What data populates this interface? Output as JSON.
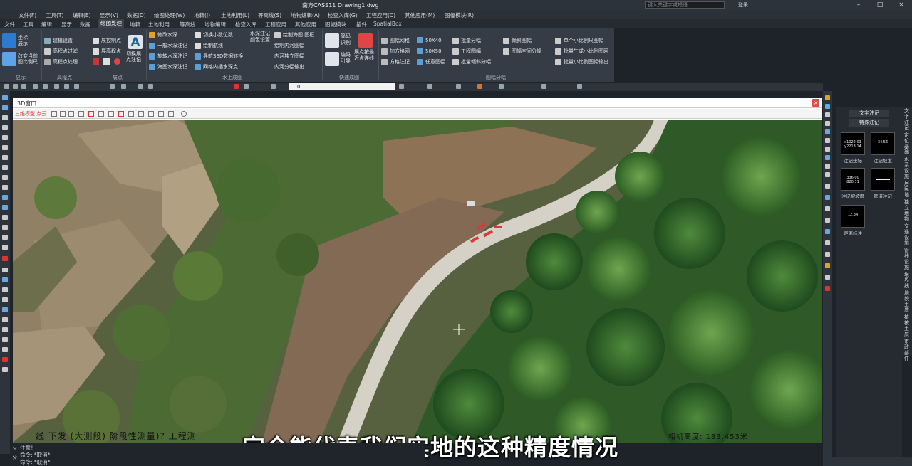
{
  "app": {
    "title": "南方CASS11   Drawing1.dwg",
    "search_placeholder": "键入关键字或短语",
    "login": "登录"
  },
  "menu": [
    "文件(F)",
    "工具(T)",
    "编辑(E)",
    "显示(V)",
    "数据(D)",
    "绘图处理(W)",
    "地籍(J)",
    "土地利用(L)",
    "等高线(S)",
    "地物编辑(A)",
    "检查入库(G)",
    "工程应用(C)",
    "其他应用(M)",
    "图幅模块(R)"
  ],
  "ribbon_tabs": [
    "文件",
    "工具",
    "编辑",
    "显示",
    "数据",
    "绘图处理",
    "地籍",
    "土地利用",
    "等高线",
    "地物编辑",
    "检查入库",
    "工程应用",
    "其他应用",
    "图幅模块",
    "插件",
    "SpatialBox"
  ],
  "ribbon_active": "绘图处理",
  "ribbon": {
    "display_group": "显示",
    "display_items": [
      "坐标展示",
      "改变当前图比例尺"
    ],
    "elevation_group": "高程点",
    "elevation_items": [
      "建模设置",
      "高程点过滤",
      "高程点处理"
    ],
    "plot_group": "展点",
    "plot_items": [
      "展控制点",
      "展高程点",
      "切换展点注记"
    ],
    "water_group": "水上成图",
    "water_items": [
      "修改水深",
      "一般水深注记",
      "旋转水深注记",
      "海图水深注记",
      "切换小数位数",
      "绘制航线",
      "导航SSD数据转换",
      "网格内插水深点",
      "水深注记颜色设置",
      "绘制海图 图框",
      "绘制内河图幅",
      "内河独立图幅",
      "内河分幅输出"
    ],
    "fast_group": "快速成图",
    "fast_items": [
      "简码识别",
      "展点按最近点连线",
      "编码引导"
    ],
    "frame_group": "图幅分幅",
    "frame_items": [
      "图幅网格",
      "加方格网",
      "方格注记",
      "50X40",
      "50X50",
      "任意图幅",
      "批量分幅",
      "工程图幅",
      "批量倾斜分幅",
      "倾斜图幅",
      "图幅空间分幅",
      "单个小比例尺图幅",
      "批量生成小比例图网",
      "批量小比例图幅输出"
    ]
  },
  "toolbar": {
    "layer_value": "0"
  },
  "window3d": {
    "title": "3D窗口",
    "tool_label": "三维模型 点云",
    "overlay_left": "线 下发 (大测段) 阶段性测量)? 工程测",
    "overlay_right": "相机高度: 183.453米"
  },
  "subtitle": "完全能代表我们实地的这种精度情况",
  "command": {
    "lines": [
      "注意！",
      "命令: *取消*",
      "命令: *取消*"
    ]
  },
  "palette": {
    "tabs": [
      "文字注记",
      "特殊注记"
    ],
    "items": [
      {
        "label": "注记坐标",
        "thumb": "x1022.03\ny2213.14"
      },
      {
        "label": "注记坡度",
        "thumb": "34.56"
      },
      {
        "label": "注记坡坡度",
        "thumb": "336.00\n820.31"
      },
      {
        "label": "管道注记",
        "thumb": ""
      },
      {
        "label": "距离标注",
        "thumb": "12.34"
      }
    ],
    "vertical_tabs": [
      "文字注记",
      "定位基础",
      "水系设施",
      "居民地",
      "独立地物",
      "交通设施",
      "管线设施",
      "境界线",
      "地貌土质",
      "植被土质",
      "市政部件"
    ]
  },
  "colors": {
    "accent": "#2a7bd1",
    "close": "#e24b4b"
  }
}
